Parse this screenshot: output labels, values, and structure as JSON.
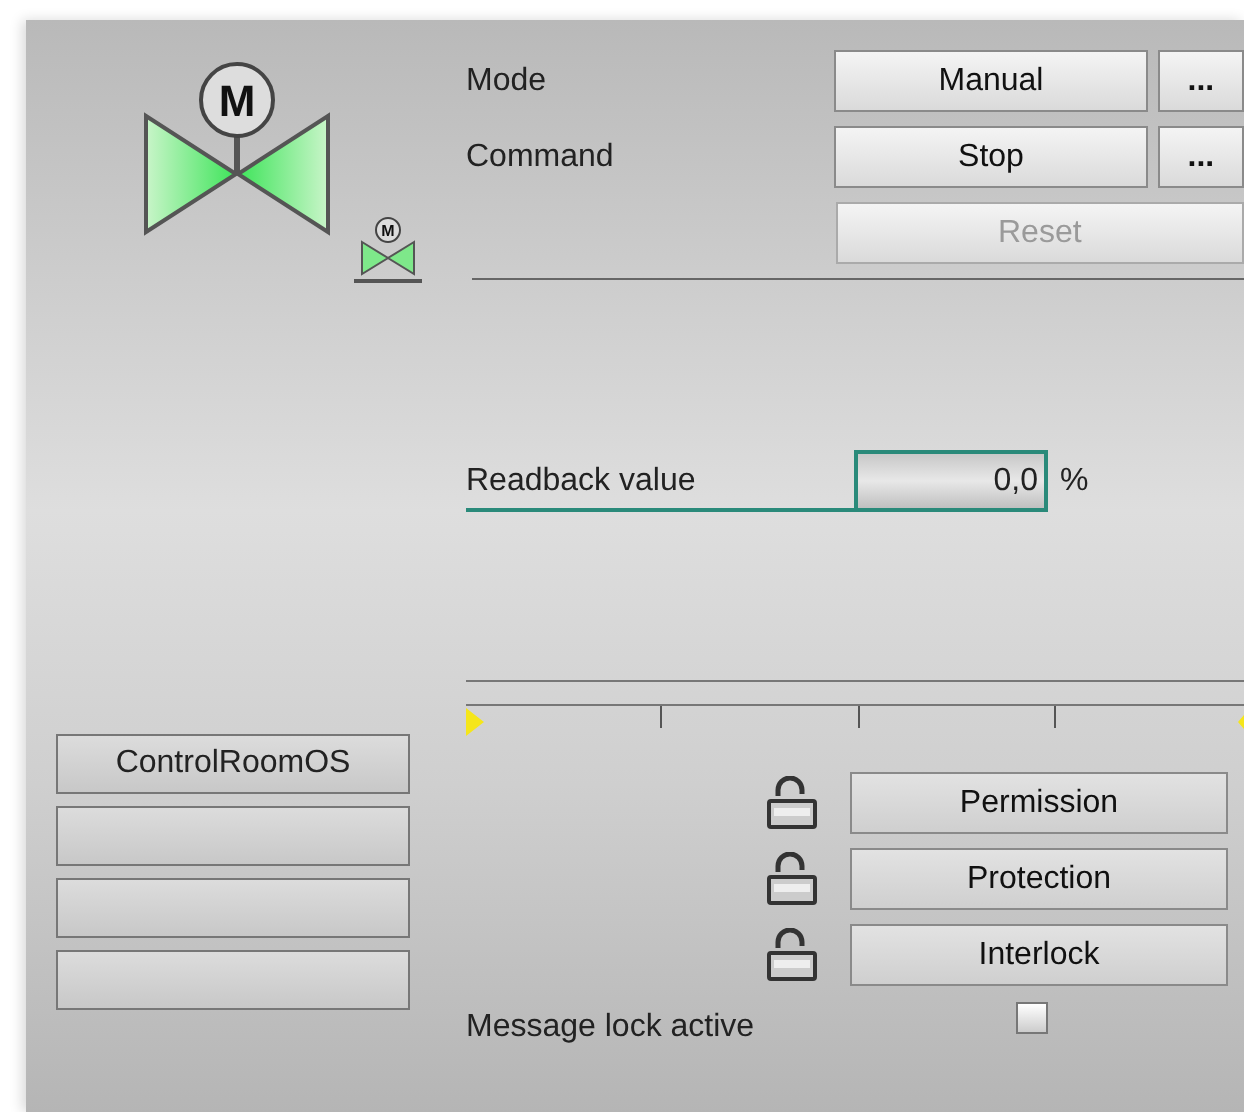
{
  "valve": {
    "symbol": "M",
    "small_symbol": "M"
  },
  "mode": {
    "label": "Mode",
    "value": "Manual",
    "more": "..."
  },
  "command": {
    "label": "Command",
    "value": "Stop",
    "more": "..."
  },
  "reset": {
    "label": "Reset",
    "disabled": true
  },
  "readback": {
    "label": "Readback value",
    "value": "0,0",
    "unit": "%"
  },
  "scale": {
    "level": 0
  },
  "operators": [
    {
      "kind": "named",
      "label": "ControlRoomOS"
    },
    {
      "kind": "empty"
    },
    {
      "kind": "empty"
    },
    {
      "kind": "empty"
    }
  ],
  "locks": [
    {
      "label": "Permission",
      "locked": false
    },
    {
      "label": "Protection",
      "locked": false
    },
    {
      "label": "Interlock",
      "locked": false
    }
  ],
  "message_lock": {
    "label": "Message lock active",
    "checked": false
  }
}
